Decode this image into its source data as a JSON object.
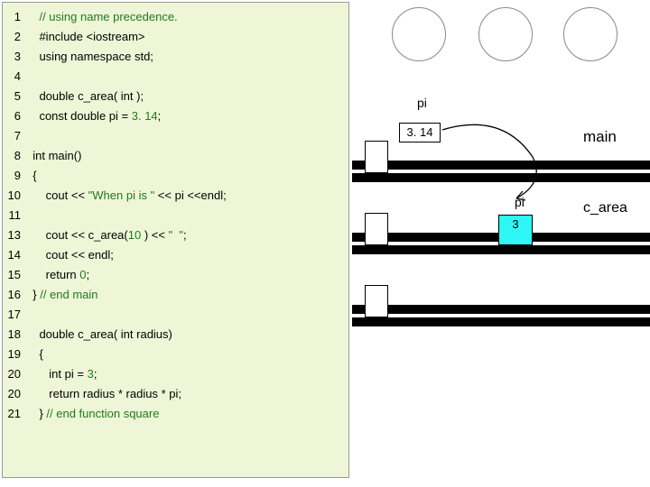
{
  "lines": [
    {
      "n": "1",
      "indent": "    ",
      "tokens": [
        {
          "t": "// using name precedence.",
          "c": "cm"
        }
      ]
    },
    {
      "n": "2",
      "indent": "    ",
      "tokens": [
        {
          "t": "#include <iostream>"
        }
      ]
    },
    {
      "n": "3",
      "indent": "    ",
      "tokens": [
        {
          "t": "using namespace std;"
        }
      ]
    },
    {
      "n": "4",
      "indent": "",
      "tokens": []
    },
    {
      "n": "5",
      "indent": "    ",
      "tokens": [
        {
          "t": "double c_area( int );"
        }
      ]
    },
    {
      "n": "6",
      "indent": "    ",
      "tokens": [
        {
          "t": "const double pi = "
        },
        {
          "t": "3. 14",
          "c": "num"
        },
        {
          "t": ";"
        }
      ]
    },
    {
      "n": "7",
      "indent": "",
      "tokens": []
    },
    {
      "n": "8",
      "indent": "  ",
      "tokens": [
        {
          "t": "int main()"
        }
      ]
    },
    {
      "n": "9",
      "indent": "  ",
      "tokens": [
        {
          "t": "{"
        }
      ]
    },
    {
      "n": "10",
      "indent": "      ",
      "tokens": [
        {
          "t": "cout << "
        },
        {
          "t": "\"When pi is \"",
          "c": "str"
        },
        {
          "t": " << pi <<endl;"
        }
      ]
    },
    {
      "n": "11",
      "indent": "",
      "tokens": []
    },
    {
      "n": "13",
      "indent": "      ",
      "tokens": [
        {
          "t": "cout << c_area("
        },
        {
          "t": "10",
          "c": "num"
        },
        {
          "t": " ) << "
        },
        {
          "t": "\"  \"",
          "c": "str"
        },
        {
          "t": ";"
        }
      ]
    },
    {
      "n": "14",
      "indent": "      ",
      "tokens": [
        {
          "t": "cout << endl;"
        }
      ]
    },
    {
      "n": "15",
      "indent": "      ",
      "tokens": [
        {
          "t": "return "
        },
        {
          "t": "0",
          "c": "num"
        },
        {
          "t": ";"
        }
      ]
    },
    {
      "n": "16",
      "indent": "  ",
      "tokens": [
        {
          "t": "} "
        },
        {
          "t": "// end main",
          "c": "cm"
        }
      ]
    },
    {
      "n": "17",
      "indent": "",
      "tokens": []
    },
    {
      "n": "18",
      "indent": "    ",
      "tokens": [
        {
          "t": "double c_area( int radius)"
        }
      ]
    },
    {
      "n": "19",
      "indent": "    ",
      "tokens": [
        {
          "t": "{"
        }
      ]
    },
    {
      "n": "20",
      "indent": "       ",
      "tokens": [
        {
          "t": "int pi = "
        },
        {
          "t": "3",
          "c": "num"
        },
        {
          "t": ";"
        }
      ]
    },
    {
      "n": "20",
      "indent": "       ",
      "tokens": [
        {
          "t": "return radius * radius * pi;"
        }
      ]
    },
    {
      "n": "21",
      "indent": "    ",
      "tokens": [
        {
          "t": "} "
        },
        {
          "t": "// end function square",
          "c": "cm"
        }
      ]
    }
  ],
  "diagram": {
    "pi_global_label": "pi",
    "pi_global_value": "3. 14",
    "main_label": "main",
    "pi_local_label": "pi",
    "pi_local_value": "3",
    "c_area_label": "c_area"
  }
}
